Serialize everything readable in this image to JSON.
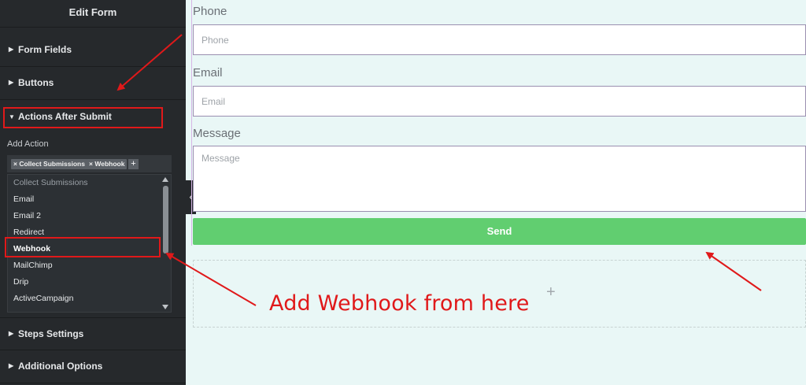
{
  "sidebar": {
    "title": "Edit Form",
    "sections": [
      "Form Fields",
      "Buttons",
      "Actions After Submit"
    ],
    "add_action_label": "Add Action",
    "selected_tags": [
      "Collect Submissions",
      "Webhook"
    ],
    "tag_add_symbol": "+",
    "tag_remove_symbol": "×",
    "options": [
      "Collect Submissions",
      "Email",
      "Email 2",
      "Redirect",
      "Webhook",
      "MailChimp",
      "Drip",
      "ActiveCampaign"
    ],
    "bottom_sections": [
      "Steps Settings",
      "Additional Options"
    ],
    "collapse_symbol": "‹"
  },
  "form": {
    "phone_label": "Phone",
    "phone_placeholder": "Phone",
    "email_label": "Email",
    "email_placeholder": "Email",
    "message_label": "Message",
    "message_placeholder": "Message",
    "send_label": "Send",
    "add_symbol": "+"
  },
  "annotation": {
    "text": "Add Webhook from here"
  },
  "colors": {
    "sidebar_bg": "#26292c",
    "canvas_bg": "#e9f7f6",
    "send_button": "#61ce70",
    "annotation_red": "#e0191a"
  }
}
